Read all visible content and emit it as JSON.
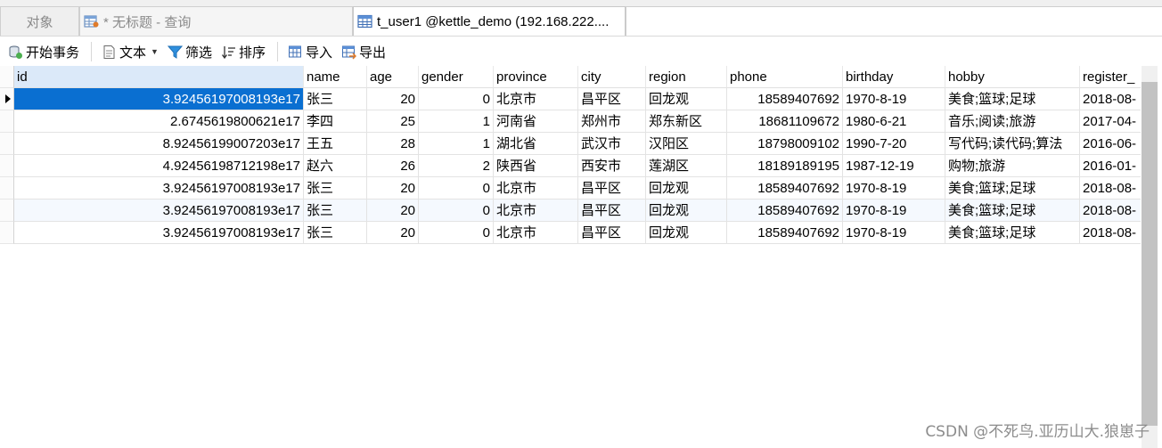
{
  "tabs": [
    {
      "label": "对象"
    },
    {
      "label": "* 无标题 - 查询"
    },
    {
      "label": "t_user1 @kettle_demo (192.168.222...."
    }
  ],
  "toolbar": {
    "begin_transaction": "开始事务",
    "text": "文本",
    "filter": "筛选",
    "sort": "排序",
    "import": "导入",
    "export": "导出"
  },
  "table": {
    "columns": [
      "id",
      "name",
      "age",
      "gender",
      "province",
      "city",
      "region",
      "phone",
      "birthday",
      "hobby",
      "register_"
    ],
    "rows": [
      [
        "3.92456197008193e17",
        "张三",
        "20",
        "0",
        "北京市",
        "昌平区",
        "回龙观",
        "18589407692",
        "1970-8-19",
        "美食;篮球;足球",
        "2018-08-"
      ],
      [
        "2.6745619800621e17",
        "李四",
        "25",
        "1",
        "河南省",
        "郑州市",
        "郑东新区",
        "18681109672",
        "1980-6-21",
        "音乐;阅读;旅游",
        "2017-04-"
      ],
      [
        "8.92456199007203e17",
        "王五",
        "28",
        "1",
        "湖北省",
        "武汉市",
        "汉阳区",
        "18798009102",
        "1990-7-20",
        "写代码;读代码;算法",
        "2016-06-"
      ],
      [
        "4.92456198712198e17",
        "赵六",
        "26",
        "2",
        "陕西省",
        "西安市",
        "莲湖区",
        "18189189195",
        "1987-12-19",
        "购物;旅游",
        "2016-01-"
      ],
      [
        "3.92456197008193e17",
        "张三",
        "20",
        "0",
        "北京市",
        "昌平区",
        "回龙观",
        "18589407692",
        "1970-8-19",
        "美食;篮球;足球",
        "2018-08-"
      ],
      [
        "3.92456197008193e17",
        "张三",
        "20",
        "0",
        "北京市",
        "昌平区",
        "回龙观",
        "18589407692",
        "1970-8-19",
        "美食;篮球;足球",
        "2018-08-"
      ],
      [
        "3.92456197008193e17",
        "张三",
        "20",
        "0",
        "北京市",
        "昌平区",
        "回龙观",
        "18589407692",
        "1970-8-19",
        "美食;篮球;足球",
        "2018-08-"
      ]
    ]
  },
  "watermark": "CSDN @不死鸟.亚历山大.狼崽子",
  "colors": {
    "selection": "#0a6fd1",
    "header_sorted": "#dbe9f9",
    "row_alt": "#f5f9fe"
  }
}
